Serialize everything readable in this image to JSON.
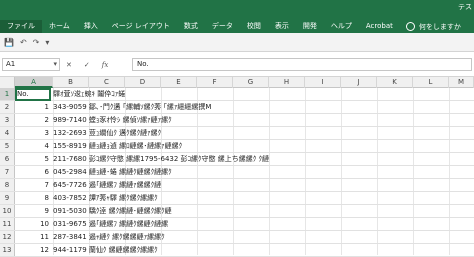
{
  "ribbon": {
    "title_right": "テス",
    "tabs": [
      "ファイル",
      "ホーム",
      "挿入",
      "ページ レイアウト",
      "数式",
      "データ",
      "校閲",
      "表示",
      "開発",
      "ヘルプ",
      "Acrobat"
    ],
    "tell_me": "何をしますか"
  },
  "qat": {
    "save": "💾",
    "undo": "↶",
    "redo": "↷",
    "customize": "▾"
  },
  "formula_bar": {
    "name_box": "A1",
    "cancel": "✕",
    "enter": "✓",
    "fx": "fx",
    "value": "No."
  },
  "columns": [
    "A",
    "B",
    "C",
    "D",
    "E",
    "F",
    "G",
    "H",
    "I",
    "J",
    "K",
    "L",
    "M"
  ],
  "rows": [
    {
      "n": "1",
      "a": "No.",
      "b": "驛ｵ萓ｿ逡ｪ蜿ｷ 鬮伜ｺｧ蜷"
    },
    {
      "n": "2",
      "a": "1",
      "b": "343-9059 鄒､･門ｸ遘 ｢縲輔ｿ縲ｸ莠 ｢縲ｧ繧繧縲撰M"
    },
    {
      "n": "3",
      "a": "2",
      "b": "989-7140 螳ｮ豕ｵ怜ｼ 縲偵ｿ縲ｧ縺ｧ縲ｸ"
    },
    {
      "n": "4",
      "a": "3",
      "b": "132-2693 荳ｭ繝仙ｸ 遘ｸ縲ｸ縺ｧ縲ｸ"
    },
    {
      "n": "5",
      "a": "4",
      "b": "155-8919 縺ｮ縺ｮ遉 縲ﾛ縺縲･縺縲ｧ縺縲ｸ"
    },
    {
      "n": "6",
      "a": "5",
      "b": "211-7680 彭ｺ縲ｸ守愍 縲縲1795-6432 彭ｺ縲ｸ守愍 縲上ち縲縲ｸ ｸ縺"
    },
    {
      "n": "7",
      "a": "6",
      "b": "045-2984 縺ｮ縺･蜷 縲縺ｸ縺縲ｸ縺縲ｸ"
    },
    {
      "n": "8",
      "a": "7",
      "b": "645-7726 遏｢縺縲ﾌ 縲縺ｧ縲縲ｸ縺"
    },
    {
      "n": "9",
      "a": "8",
      "b": "403-7852 譚ｱ莠ｬ驛 縲ｸ縲ｸ縲縲ｸ"
    },
    {
      "n": "10",
      "a": "9",
      "b": "091-5030 驕ｸ逹 縲ｸ縲縺･縺縲ｸ縲ｸ縺"
    },
    {
      "n": "11",
      "a": "10",
      "b": "031-9675 遏｢縺縲ﾌ 縲縺ｸ縲縺ｸ縺縲"
    },
    {
      "n": "12",
      "a": "11",
      "b": "287-3841 遏ｬ縺ｸ 縲ｸ縲縲縺ｧ縲縲ｸ"
    },
    {
      "n": "13",
      "a": "12",
      "b": "944-1179 蘭仙ｸ 縲縺縲縲ｸ縲縲ｸ"
    }
  ]
}
